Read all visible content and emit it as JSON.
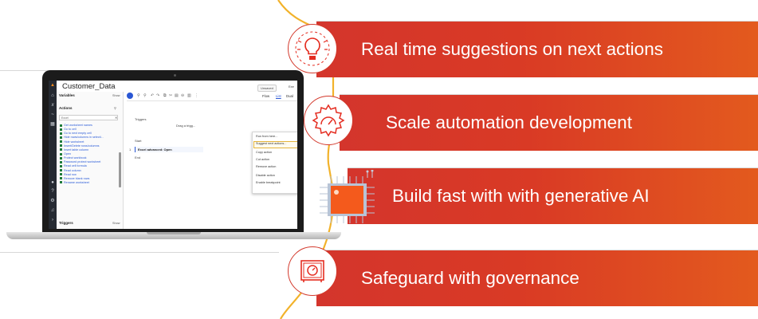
{
  "features": [
    {
      "label": "Real time suggestions on next actions",
      "icon": "lightbulb-icon"
    },
    {
      "label": "Scale automation development",
      "icon": "gear-gauge-icon"
    },
    {
      "label": "Build fast with with generative AI",
      "icon": "ai-chip-icon"
    },
    {
      "label": "Safeguard with governance",
      "icon": "safe-vault-icon"
    }
  ],
  "colors": {
    "band_start": "#d4352c",
    "band_end": "#e35a1e",
    "accent_orange": "#f2b22a",
    "icon_red": "#e42c20"
  },
  "app": {
    "title": "Customer_Data",
    "unsaved": "Unsaved",
    "variables_label": "Variables",
    "show_label": "Show",
    "actions_label": "Actions",
    "search_value": "Excel",
    "actions": [
      "Get worksheet names",
      "Go to cell",
      "Go to next empty cell",
      "Hide rows/columns in selecti...",
      "Hide worksheet",
      "Insert/Delete rows/columns",
      "Insert table column",
      "Open",
      "Protect workbook",
      "Password protect worksheet",
      "Read cell formula",
      "Read column",
      "Read row",
      "Remove blank rows",
      "Rename worksheet"
    ],
    "triggers_label": "Triggers",
    "triggers_show": "Show",
    "view_tabs": [
      "Flow",
      "List",
      "Dual"
    ],
    "flow": {
      "triggers": "Triggers",
      "drag_hint": "Drag a trigg...",
      "start": "Start",
      "step_number": "1",
      "step_label": "Excel advanced: Open",
      "end": "End"
    },
    "context_menu": [
      "Run from here...",
      "Suggest next actions...",
      "Copy action",
      "Cut action",
      "Remove action",
      "Disable action",
      "Enable breakpoint"
    ]
  }
}
